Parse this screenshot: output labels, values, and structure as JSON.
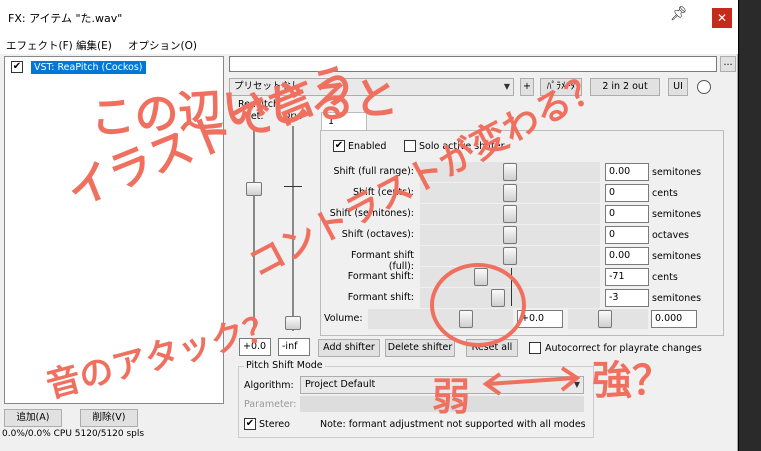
{
  "window": {
    "title": "FX: アイテム \"た.wav\"",
    "pin_icon": "pin-icon",
    "close_icon": "close-icon"
  },
  "menu": {
    "items": [
      "エフェクト(F)",
      "編集(E)",
      "オプション(O)"
    ]
  },
  "fx_list": {
    "items": [
      {
        "label": "VST: ReaPitch (Cockos)",
        "enabled": true
      }
    ],
    "add_button": "追加(A)",
    "remove_button": "削除(V)",
    "cpu": "0.0%/0.0% CPU 5120/5120 spls"
  },
  "plugin": {
    "preset": "プリセットなし",
    "plus_button": "+",
    "params_button": "ﾊﾟﾗﾒｰﾀ",
    "io_button": "2 in 2 out",
    "ui_button": "UI",
    "more_button": "...",
    "plugin_name": "ReaPitch",
    "wet_label": "Wet:",
    "dry_label": "Dry:",
    "wet_value": "+0.0",
    "dry_value": "-inf",
    "tab": "1",
    "enabled_label": "Enabled",
    "enabled": true,
    "solo_label": "Solo active shifter",
    "rows": [
      {
        "label": "Shift (full range):",
        "value": "0.00",
        "unit": "semitones"
      },
      {
        "label": "Shift (cents):",
        "value": "0",
        "unit": "cents"
      },
      {
        "label": "Shift (semitones):",
        "value": "0",
        "unit": "semitones"
      },
      {
        "label": "Shift (octaves):",
        "value": "0",
        "unit": "octaves"
      },
      {
        "label": "Formant shift (full):",
        "value": "0.00",
        "unit": "semitones"
      },
      {
        "label": "Formant shift:",
        "value": "-71",
        "unit": "cents"
      },
      {
        "label": "Formant shift:",
        "value": "-3",
        "unit": "semitones"
      }
    ],
    "volume_label": "Volume:",
    "volume_value": "+0.0",
    "pan_value": "0.000",
    "add_shifter": "Add shifter",
    "delete_shifter": "Delete shifter",
    "reset_all": "Reset all",
    "autocorrect_label": "Autocorrect for playrate changes",
    "pitch_mode_title": "Pitch Shift Mode",
    "algorithm_label": "Algorithm:",
    "algorithm_value": "Project Default",
    "parameter_label": "Parameter:",
    "stereo_label": "Stereo",
    "stereo": true,
    "note": "Note: formant adjustment not supported with all modes"
  },
  "annotations": {
    "line1": "この辺いじると",
    "line2": "イラストで言う",
    "line3": "コントラストが変わる？",
    "attack": "音のアタック？",
    "weak": "弱",
    "strong": "強？"
  },
  "colors": {
    "annotation": "#f07060",
    "selection": "#0078d7",
    "close": "#c42b1c"
  }
}
